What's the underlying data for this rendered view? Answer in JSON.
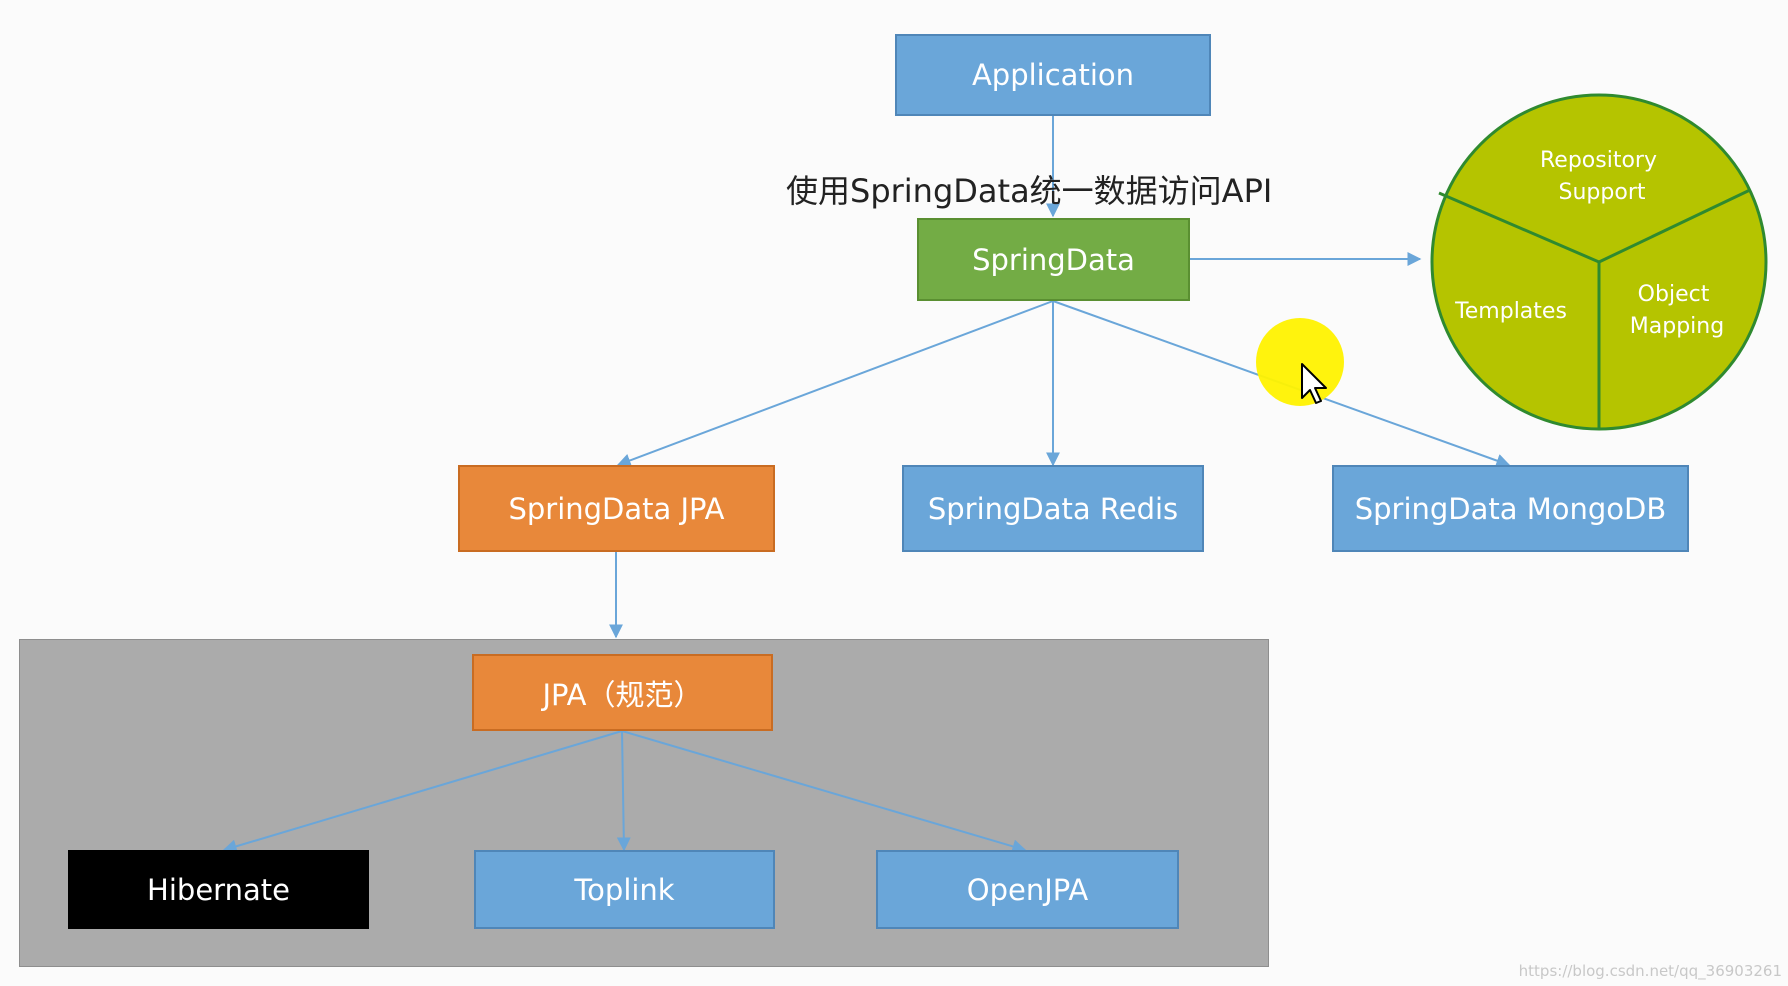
{
  "nodes": {
    "application": "Application",
    "springdata": "SpringData",
    "springdata_jpa": "SpringData JPA",
    "springdata_redis": "SpringData Redis",
    "springdata_mongodb": "SpringData MongoDB",
    "jpa_spec": "JPA（规范）",
    "hibernate": "Hibernate",
    "toplink": "Toplink",
    "openjpa": "OpenJPA"
  },
  "edge_label": "使用SpringData统一数据访问API",
  "pie_segments": {
    "repository_support": [
      "Repository",
      "Support"
    ],
    "templates": [
      "Templates"
    ],
    "object_mapping": [
      "Object",
      "Mapping"
    ]
  },
  "watermark": "https://blog.csdn.net/qq_36903261",
  "colors": {
    "blue_box": "#6aa6d9",
    "green_box": "#73ac45",
    "orange_box": "#e8883a",
    "black_box": "#000000",
    "pie_fill": "#b5c400",
    "pie_stroke": "#2f8a2f",
    "connector": "#6aa6d9",
    "gray_panel": "#ababab",
    "cursor_highlight": "#fff200"
  },
  "icons": {
    "cursor": "mouse-pointer-icon"
  }
}
